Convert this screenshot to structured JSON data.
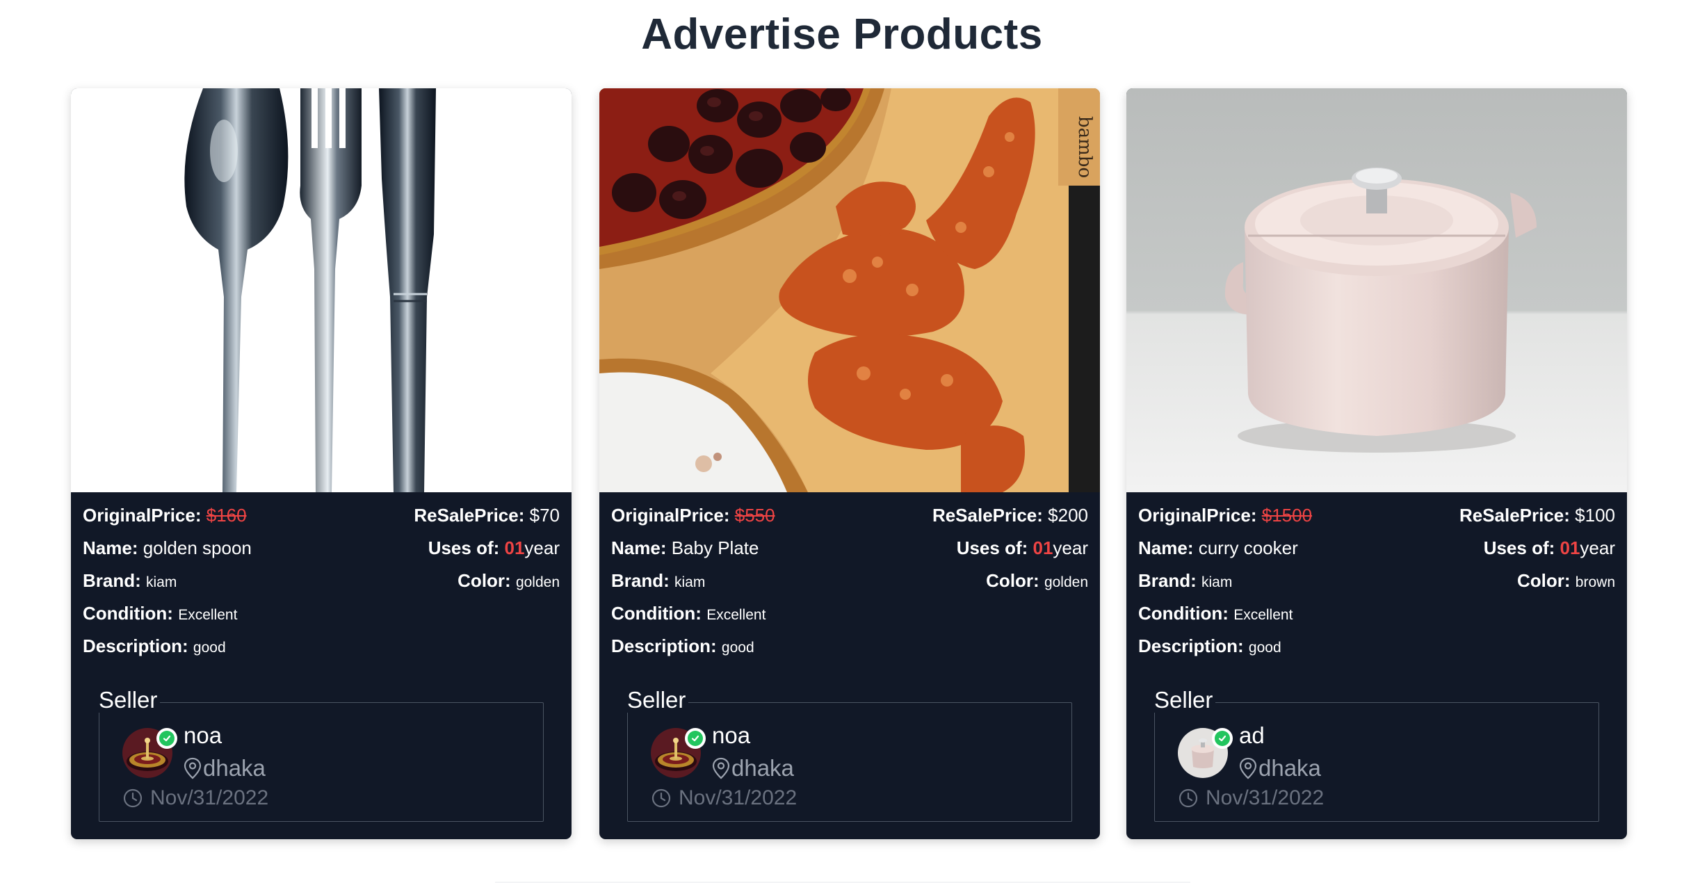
{
  "page_title": "Advertise Products",
  "labels": {
    "original_price": "OriginalPrice:",
    "resale_price": "ReSalePrice:",
    "name": "Name:",
    "uses_of": "Uses of:",
    "year": "year",
    "brand": "Brand:",
    "color": "Color:",
    "condition": "Condition:",
    "description": "Description:",
    "seller": "Seller"
  },
  "products": [
    {
      "image": "cutlery-photo",
      "original_price": "$160",
      "resale_price": "$70",
      "name": "golden spoon",
      "uses": "01",
      "brand": "kiam",
      "color": "golden",
      "condition": "Excellent",
      "description": "good",
      "seller": {
        "name": "noa",
        "location": "dhaka",
        "date": "Nov/31/2022",
        "avatar": "roulette-avatar"
      }
    },
    {
      "image": "baby-plate-food-photo",
      "original_price": "$550",
      "resale_price": "$200",
      "name": "Baby Plate",
      "uses": "01",
      "brand": "kiam",
      "color": "golden",
      "condition": "Excellent",
      "description": "good",
      "seller": {
        "name": "noa",
        "location": "dhaka",
        "date": "Nov/31/2022",
        "avatar": "roulette-avatar"
      }
    },
    {
      "image": "pink-pot-photo",
      "original_price": "$1500",
      "resale_price": "$100",
      "name": "curry cooker",
      "uses": "01",
      "brand": "kiam",
      "color": "brown",
      "condition": "Excellent",
      "description": "good",
      "seller": {
        "name": "ad",
        "location": "dhaka",
        "date": "Nov/31/2022",
        "avatar": "pot-avatar"
      }
    }
  ],
  "colors": {
    "card_bg": "#111827",
    "accent_red": "#ef4444",
    "verified_green": "#22c55e",
    "muted_text": "#9ca3af",
    "title_text": "#1f2937"
  }
}
